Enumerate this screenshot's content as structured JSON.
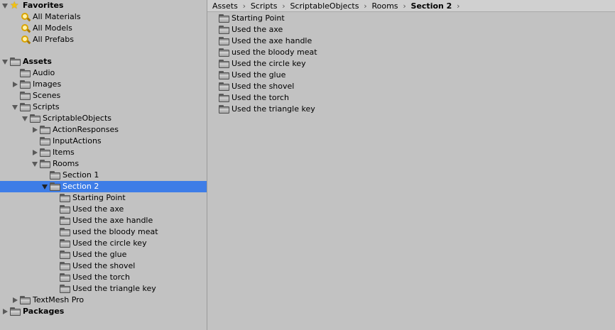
{
  "favorites": {
    "header": "Favorites",
    "items": [
      "All Materials",
      "All Models",
      "All Prefabs"
    ]
  },
  "assets": {
    "header": "Assets",
    "children": {
      "audio": "Audio",
      "images": "Images",
      "scenes": "Scenes",
      "scripts": "Scripts",
      "scriptable_objects": "ScriptableObjects",
      "action_responses": "ActionResponses",
      "input_actions": "InputActions",
      "items": "Items",
      "rooms": "Rooms",
      "section1": "Section 1",
      "section2": "Section 2",
      "textmesh_pro": "TextMesh Pro"
    }
  },
  "packages": {
    "header": "Packages"
  },
  "section2_items": [
    "Starting Point",
    "Used the axe",
    "Used the axe handle",
    "used the bloody meat",
    "Used the circle key",
    "Used the glue",
    "Used the shovel",
    "Used the torch",
    "Used the triangle key"
  ],
  "breadcrumb": [
    "Assets",
    "Scripts",
    "ScriptableObjects",
    "Rooms",
    "Section 2"
  ],
  "colors": {
    "selection": "#3e7de7",
    "background": "#c2c2c2"
  }
}
